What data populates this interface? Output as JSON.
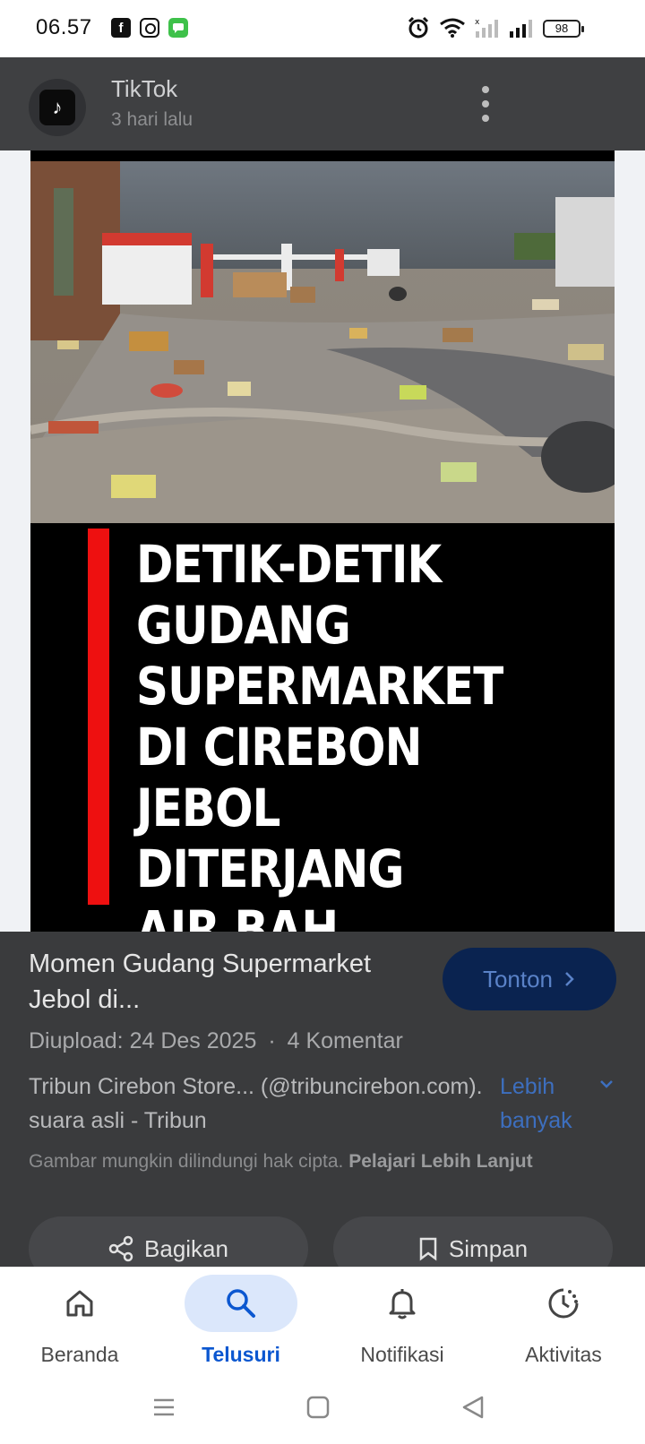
{
  "status_bar": {
    "time": "06.57",
    "battery": "98",
    "icons": [
      "facebook-icon",
      "instagram-icon",
      "message-icon",
      "alarm-icon",
      "wifi-icon",
      "signal-icon"
    ]
  },
  "source": {
    "name": "TikTok",
    "time_ago": "3 hari lalu"
  },
  "media": {
    "headline": "DETIK-DETIK\nGUDANG\nSUPERMARKET\nDI CIREBON\nJEBOL DITERJANG\nAIR BAH"
  },
  "info": {
    "title": "Momen Gudang Supermarket Jebol di...",
    "watch_label": "Tonton",
    "upload_date": "Diupload: 24 Des 2025",
    "separator": "·",
    "comments": "4 Komentar",
    "description": "Tribun Cirebon Store... (@tribuncirebon.com). suara asli - Tribun",
    "more_label": "Lebih banyak",
    "copyright_text": "Gambar mungkin dilindungi hak cipta.",
    "learn_more": "Pelajari Lebih Lanjut",
    "share_label": "Bagikan",
    "save_label": "Simpan"
  },
  "bottom_nav": {
    "items": [
      {
        "label": "Beranda",
        "icon": "home-icon"
      },
      {
        "label": "Telusuri",
        "icon": "search-icon",
        "active": true
      },
      {
        "label": "Notifikasi",
        "icon": "bell-icon"
      },
      {
        "label": "Aktivitas",
        "icon": "activity-icon"
      }
    ]
  },
  "colors": {
    "accent": "#0b57d0",
    "active_pill": "#dbe7fb",
    "overlay_bg": "#3a3b3d",
    "headline_bar": "#ee1010"
  }
}
